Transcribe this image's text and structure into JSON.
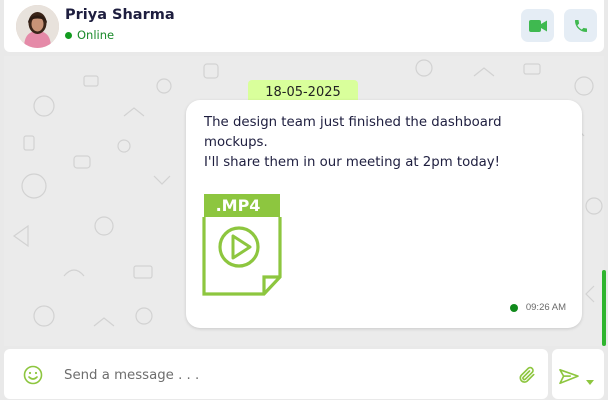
{
  "contact": {
    "name": "Priya Sharma",
    "status": "Online",
    "status_color": "#129b1f"
  },
  "header_actions": [
    {
      "icon": "video-camera-icon",
      "color": "#3fb950"
    },
    {
      "icon": "phone-icon",
      "color": "#3fb950"
    }
  ],
  "chat": {
    "date_label": "18-05-2025",
    "date_pill_color": "#d9ff9b",
    "messages": [
      {
        "lines": [
          "The design team just finished the dashboard",
          "mockups.",
          "I'll share them in our meeting at 2pm today!"
        ],
        "attachment": {
          "type": "video",
          "label": ".MP4",
          "color": "#8dc63f"
        },
        "time": "09:26 AM"
      }
    ]
  },
  "composer": {
    "placeholder": "Send a message . . .",
    "accent_color": "#8dc63f"
  }
}
